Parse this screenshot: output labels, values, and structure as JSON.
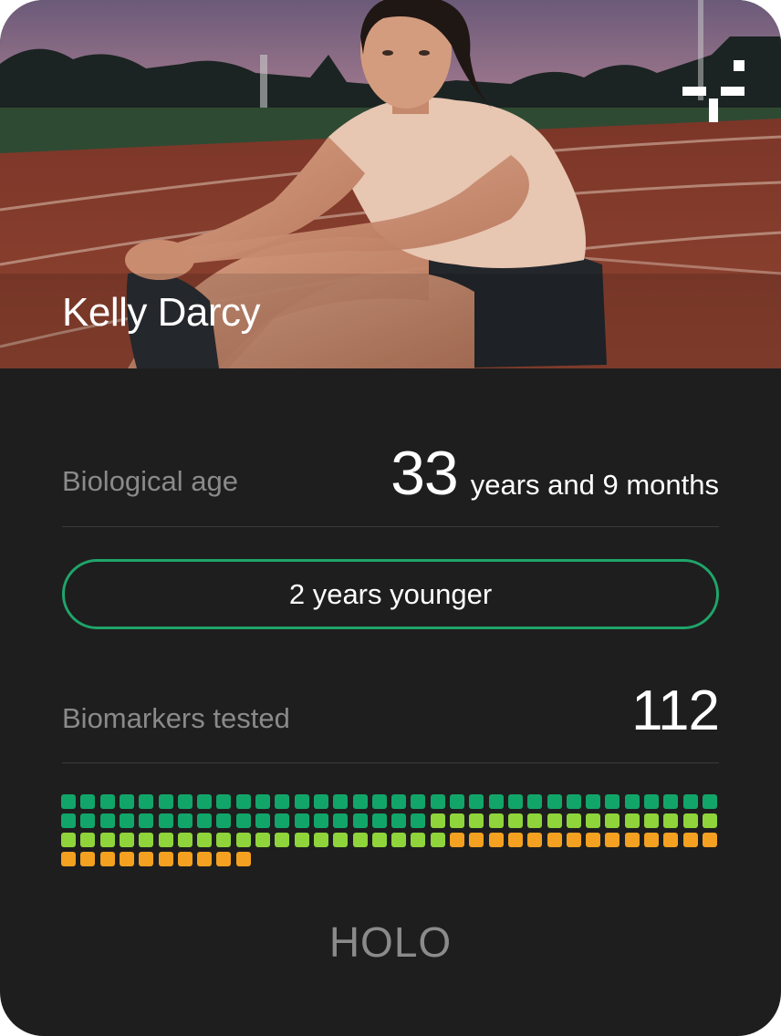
{
  "profile": {
    "name": "Kelly Darcy",
    "photo_icon": "athlete-photo"
  },
  "brand": {
    "mark_icon": "holo-plus-icon",
    "logo_text": "HOLO"
  },
  "biological_age": {
    "label": "Biological age",
    "years": "33",
    "unit_text": "years and 9 months"
  },
  "age_delta": {
    "text": "2 years younger",
    "border_color": "#1fa56a"
  },
  "biomarkers": {
    "label": "Biomarkers tested",
    "count": "112",
    "total": 112,
    "optimal_count": 53,
    "in_range_count": 35,
    "out_of_range_count": 24,
    "colors": {
      "optimal": "#12a56a",
      "in_range": "#8fd43a",
      "out_of_range": "#f4a020"
    }
  },
  "colors": {
    "card_background": "#1e1e1e",
    "label_gray": "#8a8a8a",
    "text_white": "#ffffff"
  }
}
